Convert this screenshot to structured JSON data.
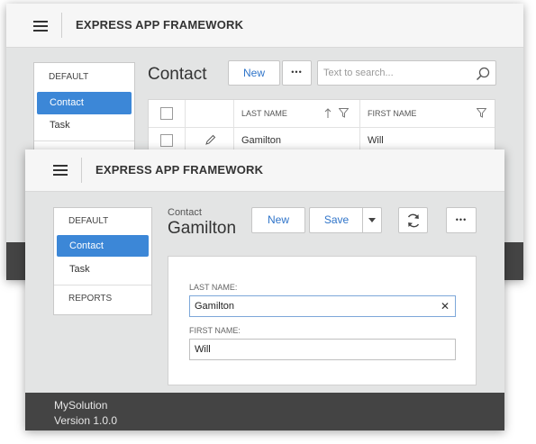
{
  "app": {
    "title": "EXPRESS APP FRAMEWORK"
  },
  "back_window": {
    "navigation": {
      "group_default": "DEFAULT",
      "items": [
        {
          "label": "Contact",
          "active": true
        },
        {
          "label": "Task",
          "active": false
        }
      ]
    },
    "view_title": "Contact",
    "toolbar": {
      "new_label": "New",
      "more_label": "•••"
    },
    "search": {
      "placeholder": "Text to search..."
    },
    "grid": {
      "columns": {
        "last_name": "LAST NAME",
        "first_name": "FIRST NAME"
      },
      "rows": [
        {
          "last_name": "Gamilton",
          "first_name": "Will"
        }
      ]
    }
  },
  "front_window": {
    "navigation": {
      "group_default": "DEFAULT",
      "items": [
        {
          "label": "Contact",
          "active": true
        },
        {
          "label": "Task",
          "active": false
        }
      ],
      "group_reports": "REPORTS"
    },
    "breadcrumb": "Contact",
    "record_title": "Gamilton",
    "toolbar": {
      "new_label": "New",
      "save_label": "Save",
      "more_label": "•••"
    },
    "form": {
      "last_name_label": "LAST NAME:",
      "last_name_value": "Gamilton",
      "first_name_label": "FIRST NAME:",
      "first_name_value": "Will",
      "clear_glyph": "✕"
    },
    "footer": {
      "solution": "MySolution",
      "version": "Version 1.0.0"
    }
  },
  "icons": [
    "hamburger-icon",
    "search-icon",
    "sort-up-icon",
    "filter-icon",
    "edit-pencil-icon",
    "dropdown-caret-icon",
    "refresh-icon",
    "clear-icon"
  ],
  "colors": {
    "accent": "#3c87d7",
    "link_button": "#2f74c9",
    "footer": "#444444",
    "header": "#f6f6f6",
    "content_bg": "#e3e4e4"
  }
}
